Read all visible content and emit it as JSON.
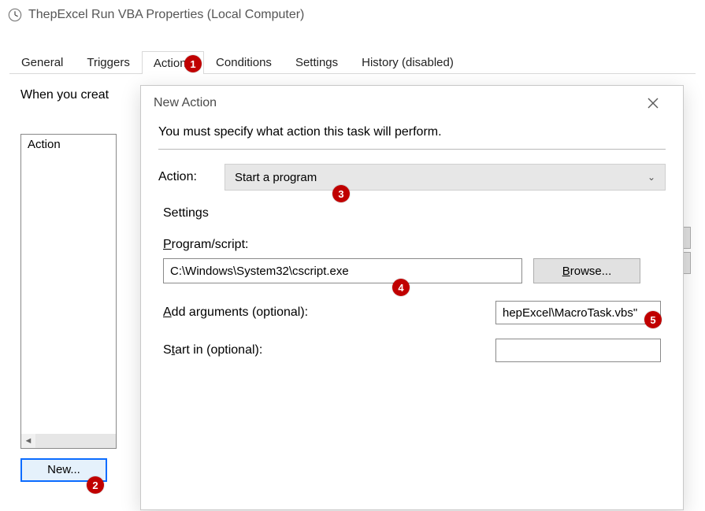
{
  "parent": {
    "title": "ThepExcel Run VBA Properties (Local Computer)",
    "tabs": [
      "General",
      "Triggers",
      "Actions",
      "Conditions",
      "Settings",
      "History (disabled)"
    ],
    "active_tab_index": 2,
    "instruction": "When you creat",
    "list_header": "Action",
    "new_button": "New..."
  },
  "modal": {
    "title": "New Action",
    "subhead": "You must specify what action this task will perform.",
    "action_label": "Action:",
    "action_value": "Start a program",
    "settings_group": "Settings",
    "program_label_pre": "P",
    "program_label_post": "rogram/script:",
    "program_value": "C:\\Windows\\System32\\cscript.exe",
    "browse_pre": "B",
    "browse_post": "rowse...",
    "args_label_pre": "A",
    "args_label_post": "dd arguments (optional):",
    "args_value": "hepExcel\\MacroTask.vbs\"",
    "startin_label_pre": "S",
    "startin_label_post": "tart in (optional):",
    "startin_value": ""
  },
  "badges": [
    "1",
    "2",
    "3",
    "4",
    "5"
  ]
}
